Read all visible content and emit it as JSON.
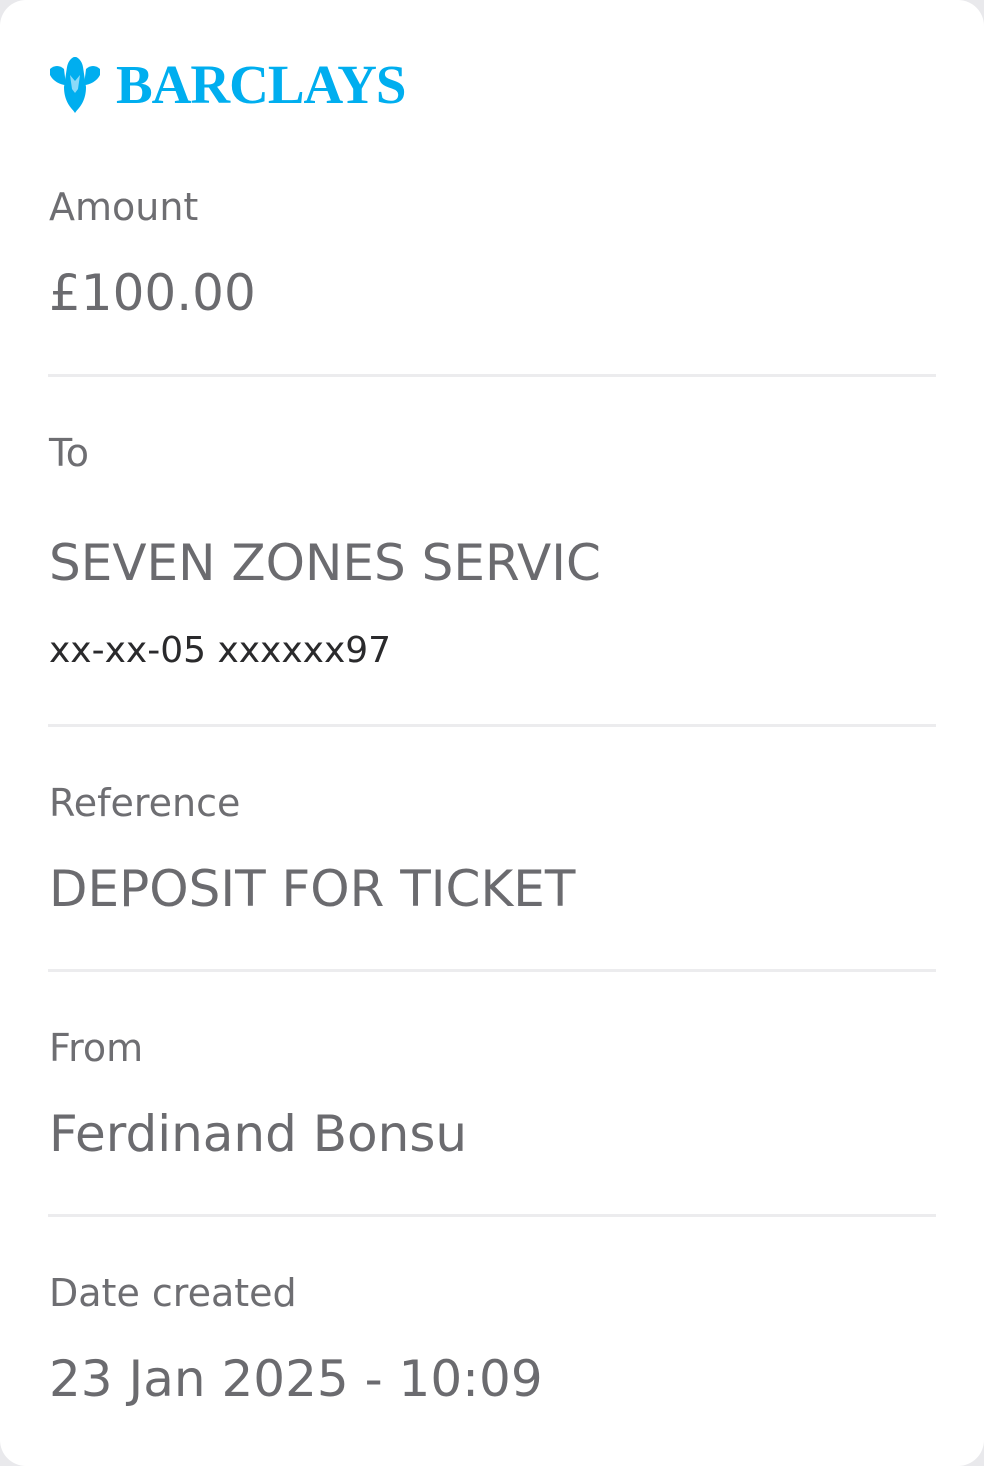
{
  "brand": {
    "name": "BARCLAYS",
    "color": "#00aeef",
    "logo_icon": "eagle-icon"
  },
  "details": {
    "amount": {
      "label": "Amount",
      "value": "£100.00"
    },
    "to": {
      "label": "To",
      "value": "SEVEN ZONES SERVIC",
      "account": "xx-xx-05 xxxxxx97"
    },
    "reference": {
      "label": "Reference",
      "value": "DEPOSIT FOR TICKET"
    },
    "from": {
      "label": "From",
      "value": "Ferdinand Bonsu"
    },
    "date_created": {
      "label": "Date created",
      "value": "23 Jan 2025 - 10:09"
    }
  }
}
